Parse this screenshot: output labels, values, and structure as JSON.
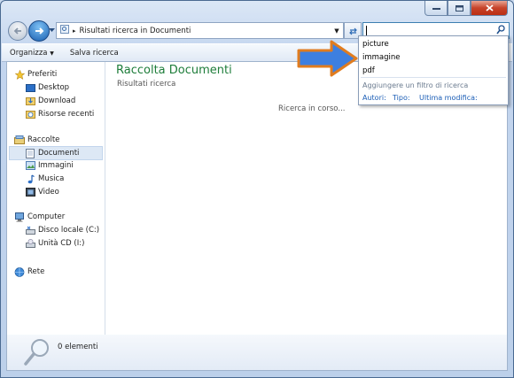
{
  "window": {
    "accent": "#3c7fb1",
    "close_color": "#c7432a"
  },
  "address": {
    "path": "Risultati ricerca in Documenti"
  },
  "search": {
    "value": ""
  },
  "toolbar": {
    "organize_label": "Organizza",
    "save_search_label": "Salva ricerca"
  },
  "nav": {
    "favorites": {
      "label": "Preferiti",
      "items": [
        "Desktop",
        "Download",
        "Risorse recenti"
      ]
    },
    "libraries": {
      "label": "Raccolte",
      "items": [
        "Documenti",
        "Immagini",
        "Musica",
        "Video"
      ]
    },
    "computer": {
      "label": "Computer",
      "items": [
        "Disco locale (C:)",
        "Unità CD (I:)"
      ]
    },
    "network": {
      "label": "Rete"
    }
  },
  "main": {
    "title": "Raccolta Documenti",
    "subtitle": "Risultati ricerca",
    "status": "Ricerca in corso..."
  },
  "details": {
    "count": "0 elementi"
  },
  "suggestions": {
    "items": [
      "picture",
      "immagine",
      "pdf"
    ],
    "hint": "Aggiungere un filtro di ricerca",
    "filters": [
      "Autori:",
      "Tipo:",
      "Ultima modifica:"
    ]
  },
  "annotation": {
    "arrow_color": "#3d7fe0",
    "arrow_outline": "#e07c1f"
  }
}
